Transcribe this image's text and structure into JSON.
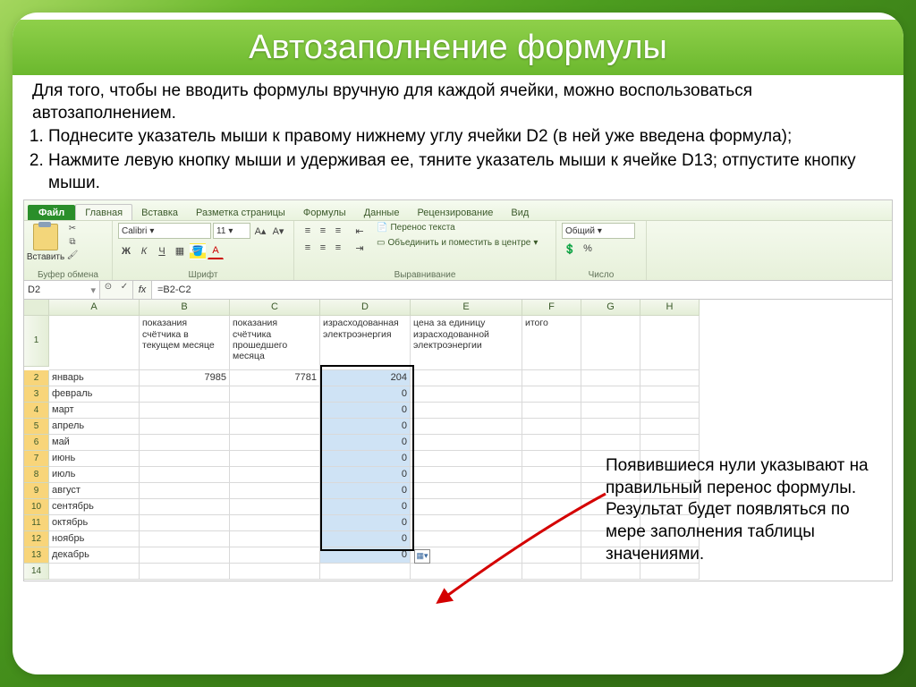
{
  "title": "Автозаполнение формулы",
  "intro": "Для того, чтобы не вводить формулы вручную для каждой ячейки, можно воспользоваться автозаполнением.",
  "steps": [
    "Поднесите указатель мыши к правому нижнему углу ячейки D2 (в ней уже введена формула);",
    "Нажмите левую кнопку мыши и удерживая ее, тяните указатель мыши к ячейке D13; отпустите кнопку мыши."
  ],
  "note": "Появившиеся нули указывают на правильный перенос формулы. Результат будет появляться по мере заполнения таблицы значениями.",
  "ribbon": {
    "file": "Файл",
    "tabs": [
      "Главная",
      "Вставка",
      "Разметка страницы",
      "Формулы",
      "Данные",
      "Рецензирование",
      "Вид"
    ],
    "paste": "Вставить",
    "clipboard_grp": "Буфер обмена",
    "font": "Calibri",
    "font_size": "11",
    "font_grp": "Шрифт",
    "align_grp": "Выравнивание",
    "wrap": "Перенос текста",
    "merge": "Объединить и поместить в центре",
    "number_fmt": "Общий",
    "number_grp": "Число"
  },
  "formula_bar": {
    "cell": "D2",
    "formula": "=B2-C2"
  },
  "columns": [
    "A",
    "B",
    "C",
    "D",
    "E",
    "F",
    "G",
    "H"
  ],
  "headers": {
    "A": "",
    "B": "показания счётчика в текущем месяце",
    "C": "показания счётчика прошедшего месяца",
    "D": "израсходованная электроэнергия",
    "E": "цена за единицу израсходованной электроэнергии",
    "F": "итого"
  },
  "rows": [
    {
      "n": 2,
      "A": "январь",
      "B": "7985",
      "C": "7781",
      "D": "204"
    },
    {
      "n": 3,
      "A": "февраль",
      "D": "0"
    },
    {
      "n": 4,
      "A": "март",
      "D": "0"
    },
    {
      "n": 5,
      "A": "апрель",
      "D": "0"
    },
    {
      "n": 6,
      "A": "май",
      "D": "0"
    },
    {
      "n": 7,
      "A": "июнь",
      "D": "0"
    },
    {
      "n": 8,
      "A": "июль",
      "D": "0"
    },
    {
      "n": 9,
      "A": "август",
      "D": "0"
    },
    {
      "n": 10,
      "A": "сентябрь",
      "D": "0"
    },
    {
      "n": 11,
      "A": "октябрь",
      "D": "0"
    },
    {
      "n": 12,
      "A": "ноябрь",
      "D": "0"
    },
    {
      "n": 13,
      "A": "декабрь",
      "D": "0"
    },
    {
      "n": 14
    }
  ]
}
